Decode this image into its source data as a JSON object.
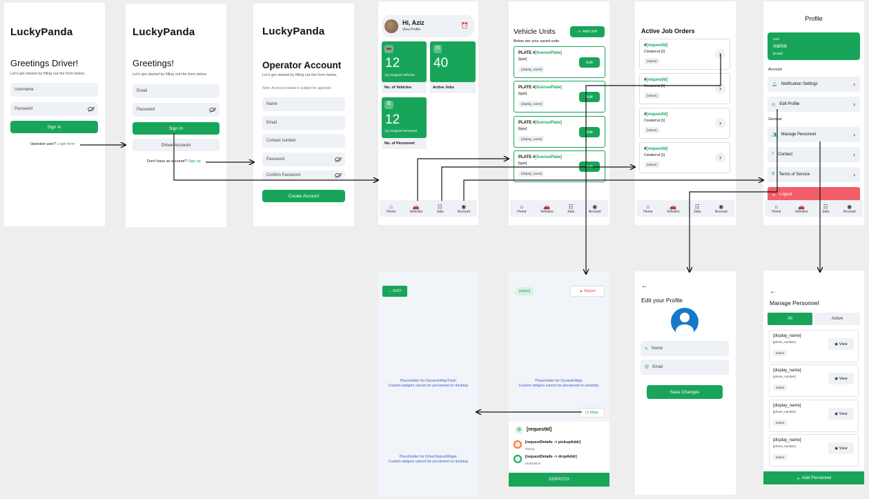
{
  "colors": {
    "accent": "#18a55a",
    "danger": "#f25d6a",
    "canvas": "#eeeeee"
  },
  "s1": {
    "logo": "LuckyPanda",
    "heading": "Greetings Driver!",
    "sub": "Let's get started by filling out the form below.",
    "username": "Username",
    "password": "Password",
    "signin": "Sign In",
    "operator_q": "Operator user?",
    "operator_link": "Login here"
  },
  "s2": {
    "logo": "LuckyPanda",
    "heading": "Greetings!",
    "sub": "Let's get started by filling out the form below.",
    "email": "Email",
    "password": "Password",
    "signin": "Sign In",
    "driver": "Driver Account",
    "q": "Don't have an account?",
    "link": "Sign up"
  },
  "s3": {
    "logo": "LuckyPanda",
    "heading": "Operator Account",
    "sub": "Let's get started by filling out the form below.",
    "note": "Note: Account created is subject for approval",
    "fields": [
      "Name",
      "Email",
      "Contact number",
      "Password",
      "Confirm Password"
    ],
    "create": "Create Account"
  },
  "s4": {
    "greeting": "Hi, Aziz",
    "view_profile": "View Profile",
    "card1_num": "12",
    "card1_sub": "[1] Assigned Vehicles",
    "card1_label": "No. of Vehicles",
    "card2_num": "40",
    "card2_label": "Active Jobs",
    "card3_num": "12",
    "card3_sub": "[1] Assigned Personnel",
    "card3_label": "No. of Personnel"
  },
  "nav": {
    "home": "Home",
    "vehicles": "Vehicles",
    "jobs": "Jobs",
    "account": "Account"
  },
  "s5": {
    "title": "Vehicle Units",
    "add": "Add Unit",
    "sub": "Below are your saved units",
    "plate_prefix": "PLATE #",
    "plate_var": "[licensePlate]",
    "type": "[type]",
    "display": "[display_name]",
    "edit": "Edit"
  },
  "s6": {
    "title": "Active Job Orders",
    "hash": "#",
    "req": "[requestId]",
    "created": "Created at [1]",
    "status": "[status]"
  },
  "s7": {
    "title": "Profile",
    "user_small": "User",
    "user_name": "name",
    "user_email": "[Email]",
    "account_section": "Account",
    "notif": "Notification Settings",
    "edit": "Edit Profile",
    "general": "General",
    "manage": "Manage Personnel",
    "contact": "Contact",
    "terms": "Terms of Service",
    "logout": "Logout"
  },
  "s8": {
    "exit": "EXIT",
    "ph1a": "Placeholder for DynamicMapTrack.",
    "ph1b": "Custom widgets cannot be previewed on desktop.",
    "ph2a": "Placeholder for DriverStatusWidget.",
    "ph2b": "Custom widgets cannot be previewed on desktop."
  },
  "s9": {
    "status": "[status]",
    "report": "Report",
    "ph_a": "Placeholder for DynamicMap.",
    "ph_b": "Custom widgets cannot be previewed on desktop.",
    "maps": "Maps",
    "req": "[requestId]",
    "pickup": "[requestDetails -> pickupAddr]",
    "pickup_lbl": "Pickup",
    "drop": "[requestDetails -> dropAddr]",
    "drop_lbl": "Destination",
    "dispatch": "DISPATCH"
  },
  "s10": {
    "title": "Edit your Profile",
    "name": "Name",
    "email": "Email",
    "save": "Save Changes"
  },
  "s11": {
    "title": "Manage Personnel",
    "tab_all": "All",
    "tab_active": "Active",
    "display": "[display_name]",
    "phone": "[phone_number]",
    "status": "status",
    "view": "View",
    "add": "Add Personnel"
  }
}
